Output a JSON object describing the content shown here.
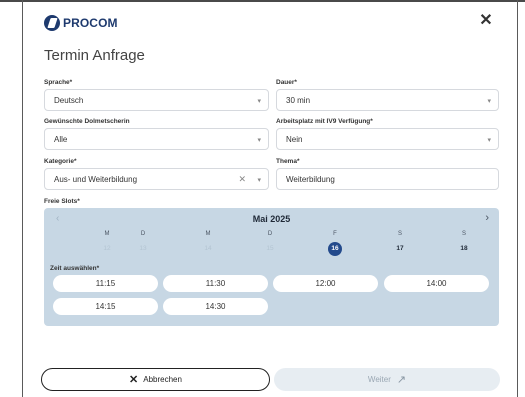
{
  "header": {
    "logo_text": "PROCOM",
    "close_icon": "close-icon"
  },
  "title": "Termin Anfrage",
  "fields": {
    "sprache": {
      "label": "Sprache*",
      "value": "Deutsch"
    },
    "dauer": {
      "label": "Dauer*",
      "value": "30 min"
    },
    "dolmetscher": {
      "label": "Gewünschte Dolmetscherin",
      "value": "Alle"
    },
    "arbeitsplatz": {
      "label": "Arbeitsplatz mit IV9 Verfügung*",
      "value": "Nein"
    },
    "kategorie": {
      "label": "Kategorie*",
      "value": "Aus- und Weiterbildung"
    },
    "thema": {
      "label": "Thema*",
      "value": "Weiterbildung"
    }
  },
  "calendar": {
    "label": "Freie Slots*",
    "month": "Mai 2025",
    "weekdays": [
      "M",
      "D",
      "M",
      "D",
      "F",
      "S",
      "S"
    ],
    "days": [
      "12",
      "13",
      "14",
      "15",
      "16",
      "17",
      "18"
    ],
    "selected_day": "16",
    "time_label": "Zeit auswählen*",
    "slots": [
      "11:15",
      "11:30",
      "12:00",
      "14:00",
      "14:15",
      "14:30"
    ]
  },
  "footer": {
    "cancel_label": "Abbrechen",
    "next_label": "Weiter"
  },
  "colors": {
    "brand": "#1e3a6e",
    "calendar_bg": "#c7d7e4",
    "selected": "#234a8c"
  }
}
